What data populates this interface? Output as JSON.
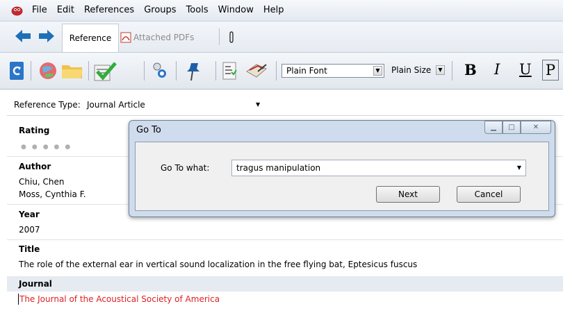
{
  "menu": [
    "File",
    "Edit",
    "References",
    "Groups",
    "Tools",
    "Window",
    "Help"
  ],
  "nav": {
    "tab_reference": "Reference",
    "tab_attached": "Attached PDFs"
  },
  "toolbar": {
    "font": "Plain Font",
    "size": "Plain Size",
    "bold": "B",
    "italic": "I",
    "underline": "U",
    "plain": "P"
  },
  "reference": {
    "type_label": "Reference Type:",
    "type_value": "Journal Article",
    "rating_label": "Rating",
    "author_label": "Author",
    "authors": [
      "Chiu, Chen",
      "Moss, Cynthia F."
    ],
    "year_label": "Year",
    "year": "2007",
    "title_label": "Title",
    "title": "The role of the external ear in vertical sound localization in the free flying bat, Eptesicus fuscus",
    "journal_label": "Journal",
    "journal": "The Journal of the Acoustical Society of America"
  },
  "dialog": {
    "title": "Go To",
    "label": "Go To what:",
    "value": "tragus manipulation",
    "next": "Next",
    "cancel": "Cancel"
  },
  "colors": {
    "journal_text": "#e02020",
    "dialog_frame": "#cfdced"
  }
}
